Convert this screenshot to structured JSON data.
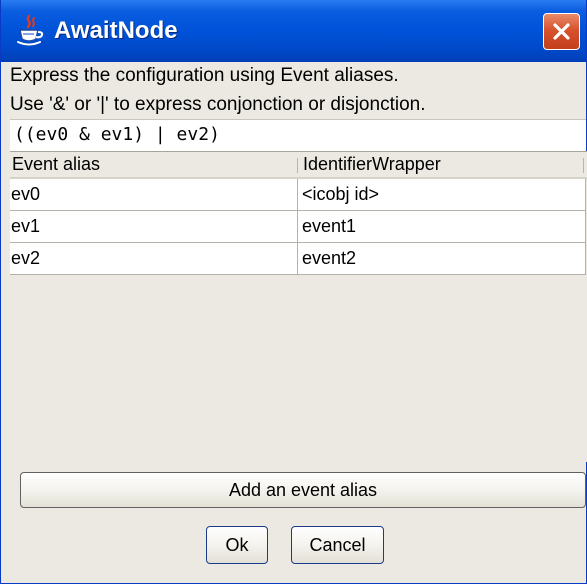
{
  "window": {
    "title": "AwaitNode",
    "title_icon": "java-cup-icon",
    "close_icon": "close-icon"
  },
  "description": {
    "line1": "Express the configuration using Event aliases.",
    "line2": "Use '&' or '|' to express conjonction or disjonction."
  },
  "expression": {
    "value": "((ev0 & ev1) | ev2)"
  },
  "table": {
    "columns": [
      "Event alias",
      "IdentifierWrapper"
    ],
    "rows": [
      [
        "ev0",
        "<icobj id>"
      ],
      [
        "ev1",
        "event1"
      ],
      [
        "ev2",
        "event2"
      ]
    ]
  },
  "buttons": {
    "add_alias": "Add an event alias",
    "ok": "Ok",
    "cancel": "Cancel"
  },
  "colors": {
    "titlebar": "#0052d8",
    "window_bg": "#ebe9e1",
    "close_button": "#d6532e"
  }
}
